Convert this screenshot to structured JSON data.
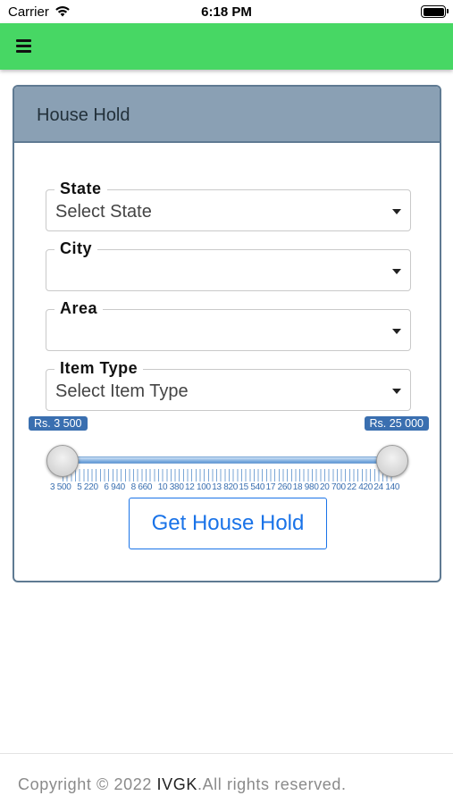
{
  "status_bar": {
    "carrier": "Carrier",
    "time": "6:18 PM"
  },
  "app_bar": {
    "menu_icon": "hamburger-menu-icon",
    "color": "#47d764"
  },
  "card": {
    "title": "House Hold",
    "fields": {
      "state": {
        "label": "State",
        "value": "Select State"
      },
      "city": {
        "label": "City",
        "value": ""
      },
      "area": {
        "label": "Area",
        "value": ""
      },
      "item_type": {
        "label": "Item Type",
        "value": "Select Item Type"
      }
    },
    "price_slider": {
      "min_label": "Rs. 3 500",
      "max_label": "Rs. 25 000",
      "min_value": 3500,
      "max_value": 25000,
      "tick_labels": [
        "3 500",
        "5 220",
        "6 940",
        "8 660",
        "10 380",
        "12 100",
        "13 820",
        "15 540",
        "17 260",
        "18 980",
        "20 700",
        "22 420",
        "24 140"
      ]
    },
    "action_button": "Get House Hold"
  },
  "footer": {
    "prefix": "Copyright © 2022 ",
    "brand": "IVGK",
    "suffix": ".All rights reserved."
  },
  "colors": {
    "accent": "#47d764",
    "header": "#8aa0b4",
    "slider": "#3a6fb0",
    "button_text": "#1a73e8"
  }
}
